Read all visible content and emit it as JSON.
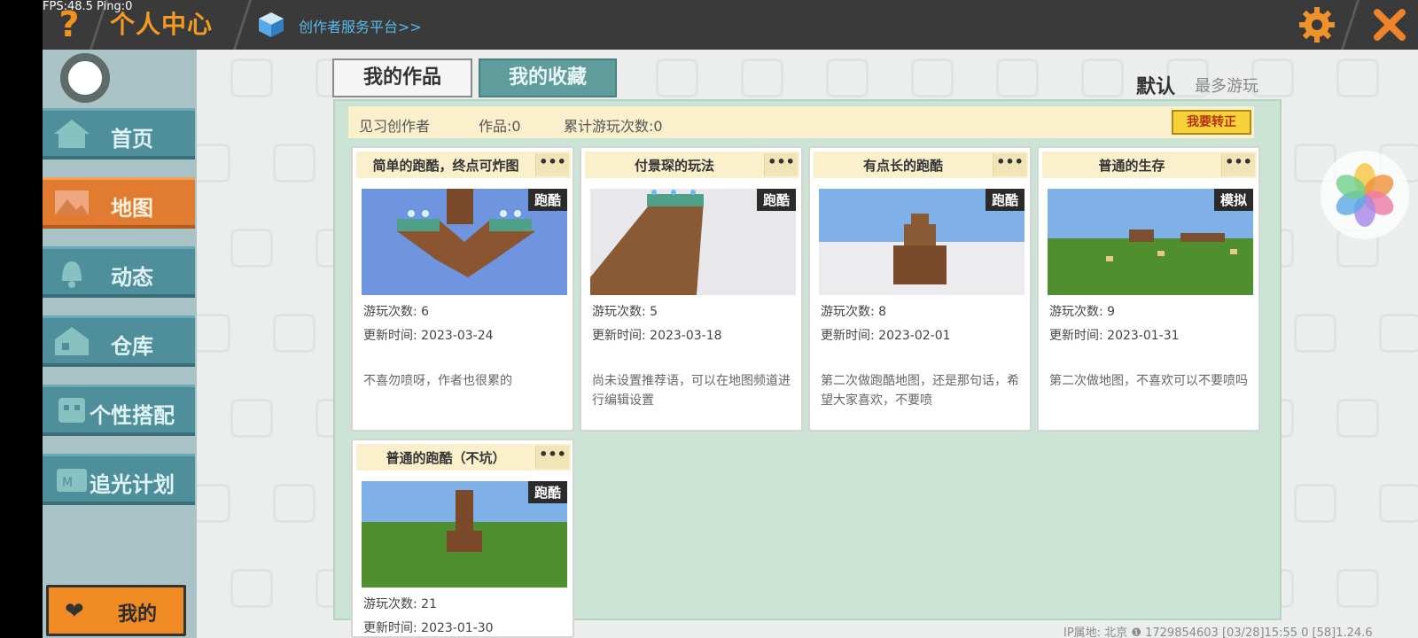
{
  "hud": {
    "fps": "FPS:48.5",
    "ping": "Ping:0"
  },
  "header": {
    "help_icon": "question-mark-icon",
    "title": "个人中心",
    "creator_platform_link": "创作者服务平台>>",
    "settings_icon": "gear-icon",
    "close_icon": "close-icon"
  },
  "sidebar": {
    "items": [
      {
        "label": "首页",
        "icon": "home-icon",
        "active": false
      },
      {
        "label": "地图",
        "icon": "map-icon",
        "active": true
      },
      {
        "label": "动态",
        "icon": "bell-icon",
        "active": false
      },
      {
        "label": "仓库",
        "icon": "house-icon",
        "active": false
      },
      {
        "label": "个性搭配",
        "icon": "character-icon",
        "active": false
      },
      {
        "label": "追光计划",
        "icon": "badge-icon",
        "active": false
      }
    ],
    "mine_button": "我的"
  },
  "tabs": {
    "works": "我的作品",
    "favorites": "我的收藏"
  },
  "sort": {
    "default": "默认",
    "most_played": "最多游玩"
  },
  "info": {
    "creator_level": "见习创作者",
    "works_count": "作品:0",
    "total_plays": "累计游玩次数:0",
    "verify_button": "我要转正"
  },
  "cards": [
    {
      "title": "简单的跑酷，终点可炸图",
      "genre": "跑酷",
      "plays": "游玩次数: 6",
      "updated": "更新时间: 2023-03-24",
      "desc": "不喜勿喷呀，作者也很累的"
    },
    {
      "title": "付景琛的玩法",
      "genre": "跑酷",
      "plays": "游玩次数: 5",
      "updated": "更新时间: 2023-03-18",
      "desc": "尚未设置推荐语，可以在地图频道进行编辑设置"
    },
    {
      "title": "有点长的跑酷",
      "genre": "跑酷",
      "plays": "游玩次数: 8",
      "updated": "更新时间: 2023-02-01",
      "desc": "第二次做跑酷地图，还是那句话，希望大家喜欢，不要喷"
    },
    {
      "title": "普通的生存",
      "genre": "模拟",
      "plays": "游玩次数: 9",
      "updated": "更新时间: 2023-01-31",
      "desc": "第二次做地图，不喜欢可以不要喷吗"
    },
    {
      "title": "普通的跑酷（不坑）",
      "genre": "跑酷",
      "plays": "游玩次数: 21",
      "updated": "更新时间: 2023-01-30",
      "desc": ""
    }
  ],
  "more_label": "•••",
  "status_bar": "IP属地: 北京 ❶   1729854603  [03/28]15:55 0  [58]1.24.6",
  "colors": {
    "accent_orange": "#f39a22",
    "nav_teal": "#4f8f9c",
    "panel_green": "#cbe4d5",
    "info_yellow": "#fbf0cc"
  }
}
